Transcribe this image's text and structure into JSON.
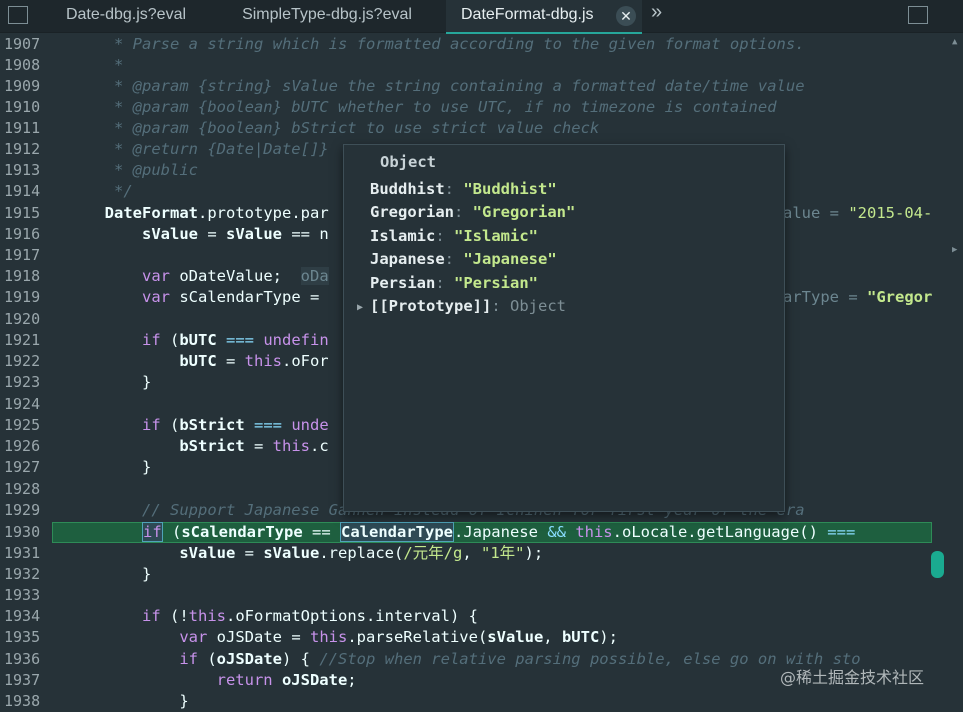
{
  "tabs": [
    {
      "label": "Date-dbg.js?eval",
      "active": false
    },
    {
      "label": "SimpleType-dbg.js?eval",
      "active": false
    },
    {
      "label": "DateFormat-dbg.js",
      "active": true
    }
  ],
  "tab_close_glyph": "✕",
  "tab_overflow_glyph": "»",
  "line_numbers": [
    "1907",
    "1908",
    "1909",
    "1910",
    "1911",
    "1912",
    "1913",
    "1914",
    "1915",
    "1916",
    "1917",
    "1918",
    "1919",
    "1920",
    "1921",
    "1922",
    "1923",
    "1924",
    "1925",
    "1926",
    "1927",
    "1928",
    "1929",
    "1930",
    "1931",
    "1932",
    "1933",
    "1934",
    "1935",
    "1936",
    "1937",
    "1938"
  ],
  "code": {
    "l1907": "* Parse a string which is formatted according to the given format options.",
    "l1908": "*",
    "l1909": "* @param {string} sValue the string containing a formatted date/time value",
    "l1910": "* @param {boolean} bUTC whether to use UTC, if no timezone is contained",
    "l1911": "* @param {boolean} bStrict to use strict value check",
    "l1912": "* @return {Date|Date[]}",
    "l1913": "* @public",
    "l1914": "*/",
    "l1915_a": "DateFormat",
    "l1915_b": ".prototype.par",
    "l1915_inline_label": "alue = ",
    "l1915_inline_val": "\"2015-04-",
    "l1916_a": "sValue",
    "l1916_b": " = ",
    "l1916_c": "sValue",
    "l1916_d": " == n",
    "l1918_kw": "var",
    "l1918_a": " oDateValue;",
    "l1918_inline": "oDa",
    "l1919_kw": "var",
    "l1919_a": " sCalendarType = ",
    "l1919_inline_label": "arType = ",
    "l1919_inline_val": "\"Gregor",
    "l1921_kw": "if",
    "l1921_a": " (",
    "l1921_b": "bUTC",
    "l1921_op": " === ",
    "l1921_c": "undefin",
    "l1922_a": "bUTC",
    "l1922_b": " = ",
    "l1922_this": "this",
    "l1922_c": ".oFor",
    "l1923": "}",
    "l1925_kw": "if",
    "l1925_a": " (",
    "l1925_b": "bStrict",
    "l1925_op": " === ",
    "l1925_c": "unde",
    "l1926_a": "bStrict",
    "l1926_b": " = ",
    "l1926_this": "this",
    "l1926_c": ".c",
    "l1927": "}",
    "l1929": "// Support Japanese Gannen instead of Ichinen for first year of the era",
    "l1930_kw": "if",
    "l1930_a": " (",
    "l1930_b": "sCalendarType",
    "l1930_op": " == ",
    "l1930_c": "CalendarType",
    "l1930_d": ".Japanese ",
    "l1930_and": "&&",
    "l1930_this": " this",
    "l1930_e": ".oLocale.getLanguage() ",
    "l1930_op2": "===",
    "l1931_a": "sValue",
    "l1931_b": " = ",
    "l1931_c": "sValue",
    "l1931_d": ".replace(",
    "l1931_re": "/元年/g",
    "l1931_e": ", ",
    "l1931_s": "\"1年\"",
    "l1931_f": ");",
    "l1932": "}",
    "l1934_kw": "if",
    "l1934_a": " (!",
    "l1934_this": "this",
    "l1934_b": ".oFormatOptions.interval) {",
    "l1935_kw": "var",
    "l1935_a": " oJSDate = ",
    "l1935_this": "this",
    "l1935_b": ".parseRelative(",
    "l1935_c": "sValue",
    "l1935_d": ", ",
    "l1935_e": "bUTC",
    "l1935_f": ");",
    "l1936_kw": "if",
    "l1936_a": " (",
    "l1936_b": "oJSDate",
    "l1936_c": ") { ",
    "l1936_cm": "//Stop when relative parsing possible, else go on with sto",
    "l1937_kw": "return",
    "l1937_a": " oJSDate",
    "l1937_b": ";",
    "l1938": "}"
  },
  "tooltip": {
    "title": "Object",
    "entries": [
      {
        "key": "Buddhist",
        "value": "\"Buddhist\""
      },
      {
        "key": "Gregorian",
        "value": "\"Gregorian\""
      },
      {
        "key": "Islamic",
        "value": "\"Islamic\""
      },
      {
        "key": "Japanese",
        "value": "\"Japanese\""
      },
      {
        "key": "Persian",
        "value": "\"Persian\""
      }
    ],
    "proto_key": "[[Prototype]]",
    "proto_value": "Object",
    "colon": ": "
  },
  "watermark": "@稀土掘金技术社区",
  "colors": {
    "accent": "#26a69a",
    "highlight": "#1e5f3f",
    "string": "#c3e88d",
    "keyword": "#c792ea",
    "comment": "#546e7a"
  }
}
